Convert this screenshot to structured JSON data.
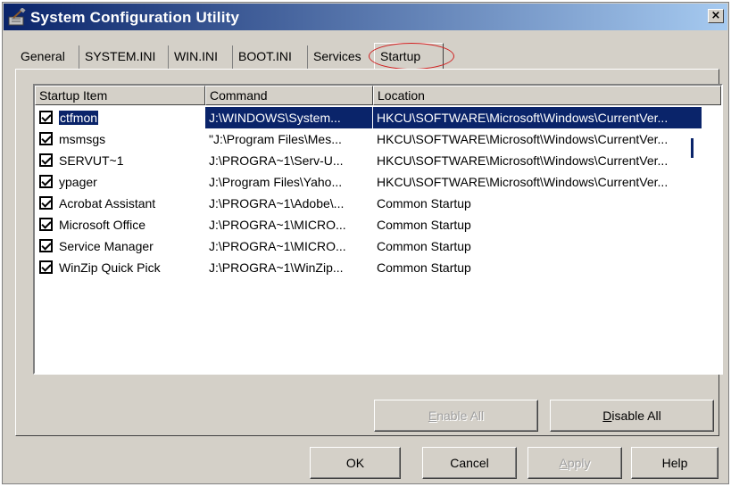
{
  "window": {
    "title": "System Configuration Utility",
    "close_label": "×"
  },
  "tabs": [
    {
      "label": "General"
    },
    {
      "label": "SYSTEM.INI"
    },
    {
      "label": "WIN.INI"
    },
    {
      "label": "BOOT.INI"
    },
    {
      "label": "Services"
    },
    {
      "label": "Startup",
      "active": true
    }
  ],
  "columns": [
    "Startup Item",
    "Command",
    "Location"
  ],
  "rows": [
    {
      "item": "ctfmon",
      "command": "J:\\WINDOWS\\System...",
      "location": "HKCU\\SOFTWARE\\Microsoft\\Windows\\CurrentVer...",
      "checked": true,
      "selected": true
    },
    {
      "item": "msmsgs",
      "command": "\"J:\\Program Files\\Mes...",
      "location": "HKCU\\SOFTWARE\\Microsoft\\Windows\\CurrentVer...",
      "checked": true
    },
    {
      "item": "SERVUT~1",
      "command": "J:\\PROGRA~1\\Serv-U...",
      "location": "HKCU\\SOFTWARE\\Microsoft\\Windows\\CurrentVer...",
      "checked": true
    },
    {
      "item": "ypager",
      "command": "J:\\Program Files\\Yaho...",
      "location": "HKCU\\SOFTWARE\\Microsoft\\Windows\\CurrentVer...",
      "checked": true
    },
    {
      "item": "Acrobat Assistant",
      "command": "J:\\PROGRA~1\\Adobe\\...",
      "location": "Common Startup",
      "checked": true
    },
    {
      "item": "Microsoft Office",
      "command": "J:\\PROGRA~1\\MICRO...",
      "location": "Common Startup",
      "checked": true
    },
    {
      "item": "Service Manager",
      "command": "J:\\PROGRA~1\\MICRO...",
      "location": "Common Startup",
      "checked": true
    },
    {
      "item": "WinZip Quick Pick",
      "command": "J:\\PROGRA~1\\WinZip...",
      "location": "Common Startup",
      "checked": true
    }
  ],
  "buttons": {
    "enable_all": "Enable All",
    "disable_all": "Disable All",
    "ok": "OK",
    "cancel": "Cancel",
    "apply": "Apply",
    "help": "Help"
  },
  "colors": {
    "title_gradient_start": "#0a246a",
    "selection": "#0a246a",
    "face": "#d4d0c8",
    "highlight_ring": "#d02020"
  },
  "icons": {
    "title": "msconfig-tools-icon",
    "close": "close-icon",
    "checkbox": "checkbox-checked-icon"
  }
}
